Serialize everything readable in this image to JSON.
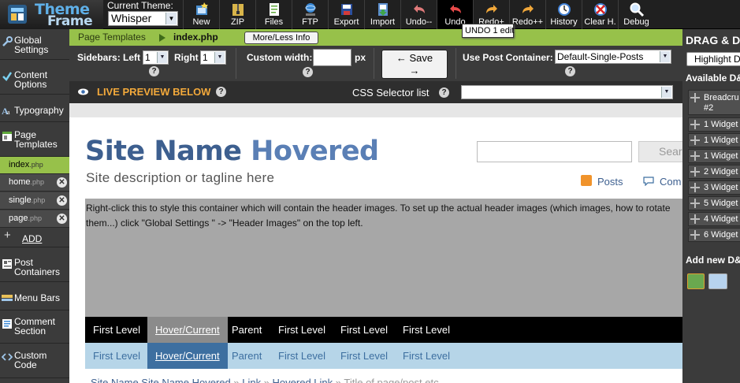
{
  "brand": {
    "line1": "Theme",
    "line2": "Frame"
  },
  "theme_switch": {
    "label": "Current Theme:",
    "value": "Whisper"
  },
  "toolbar": [
    "New",
    "ZIP",
    "Files",
    "FTP",
    "Export",
    "Import",
    "Undo--",
    "Undo",
    "Redo+",
    "Redo++",
    "History",
    "Clear H.",
    "Debug"
  ],
  "tooltip": "UNDO 1 edit",
  "sidebar": {
    "items": [
      "Global Settings",
      "Content Options",
      "Typography",
      "Page Templates"
    ],
    "templates": [
      {
        "name": "index",
        "ext": ".php"
      },
      {
        "name": "home",
        "ext": ".php"
      },
      {
        "name": "single",
        "ext": ".php"
      },
      {
        "name": "page",
        "ext": ".php"
      }
    ],
    "add": "ADD",
    "items2": [
      "Post Containers",
      "Menu Bars",
      "Comment Section",
      "Custom Code"
    ]
  },
  "breadcrumb": {
    "parent": "Page Templates",
    "current": "index.php",
    "more_less": "More/Less Info"
  },
  "options": {
    "sidebars_label": "Sidebars: Left",
    "left_value": "1",
    "right_label": "Right",
    "right_value": "1",
    "custom_width_label": "Custom width:",
    "custom_width_value": "",
    "px": "px",
    "save": "← Save →",
    "post_container_label": "Use Post Container:",
    "post_container_value": "Default-Single-Posts",
    "help": "?"
  },
  "live": {
    "label": "LIVE PREVIEW BELOW",
    "css_selector_label": "CSS Selector list",
    "css_selector_value": ""
  },
  "preview": {
    "site_name": "Site Name",
    "site_name_hover": "Hovered",
    "description": "Site description or tagline here",
    "search_placeholder": "",
    "search_button": "Sear",
    "posts_feed": "Posts",
    "comments_feed": "Com",
    "header_text": "Right-click this to style this container which will contain the header images. To set up the actual header images (which images, how to rotate them...) click \"Global Settings \" -> \"Header Images\" on the top left.",
    "nav1": [
      "First Level",
      "Hover/Current",
      "Parent",
      "First Level",
      "First Level",
      "First Level"
    ],
    "nav2": [
      "First Level",
      "Hover/Current",
      "Parent",
      "First Level",
      "First Level",
      "First Level"
    ],
    "breadcrumbs": {
      "home": "Site Name Site Name Hovered",
      "sep": " » ",
      "link": "Link",
      "hovered": "Hovered Link",
      "title": "Title of page/post etc"
    }
  },
  "right_panel": {
    "header": "DRAG & D",
    "highlight_button": "Highlight Dr",
    "available_label": "Available D&",
    "widgets": [
      "Breadcru #2",
      "1 Widget",
      "1 Widget",
      "1 Widget",
      "2 Widget",
      "3 Widget",
      "5 Widget",
      "4 Widget",
      "6 Widget"
    ],
    "add_new_label": "Add new D&"
  }
}
